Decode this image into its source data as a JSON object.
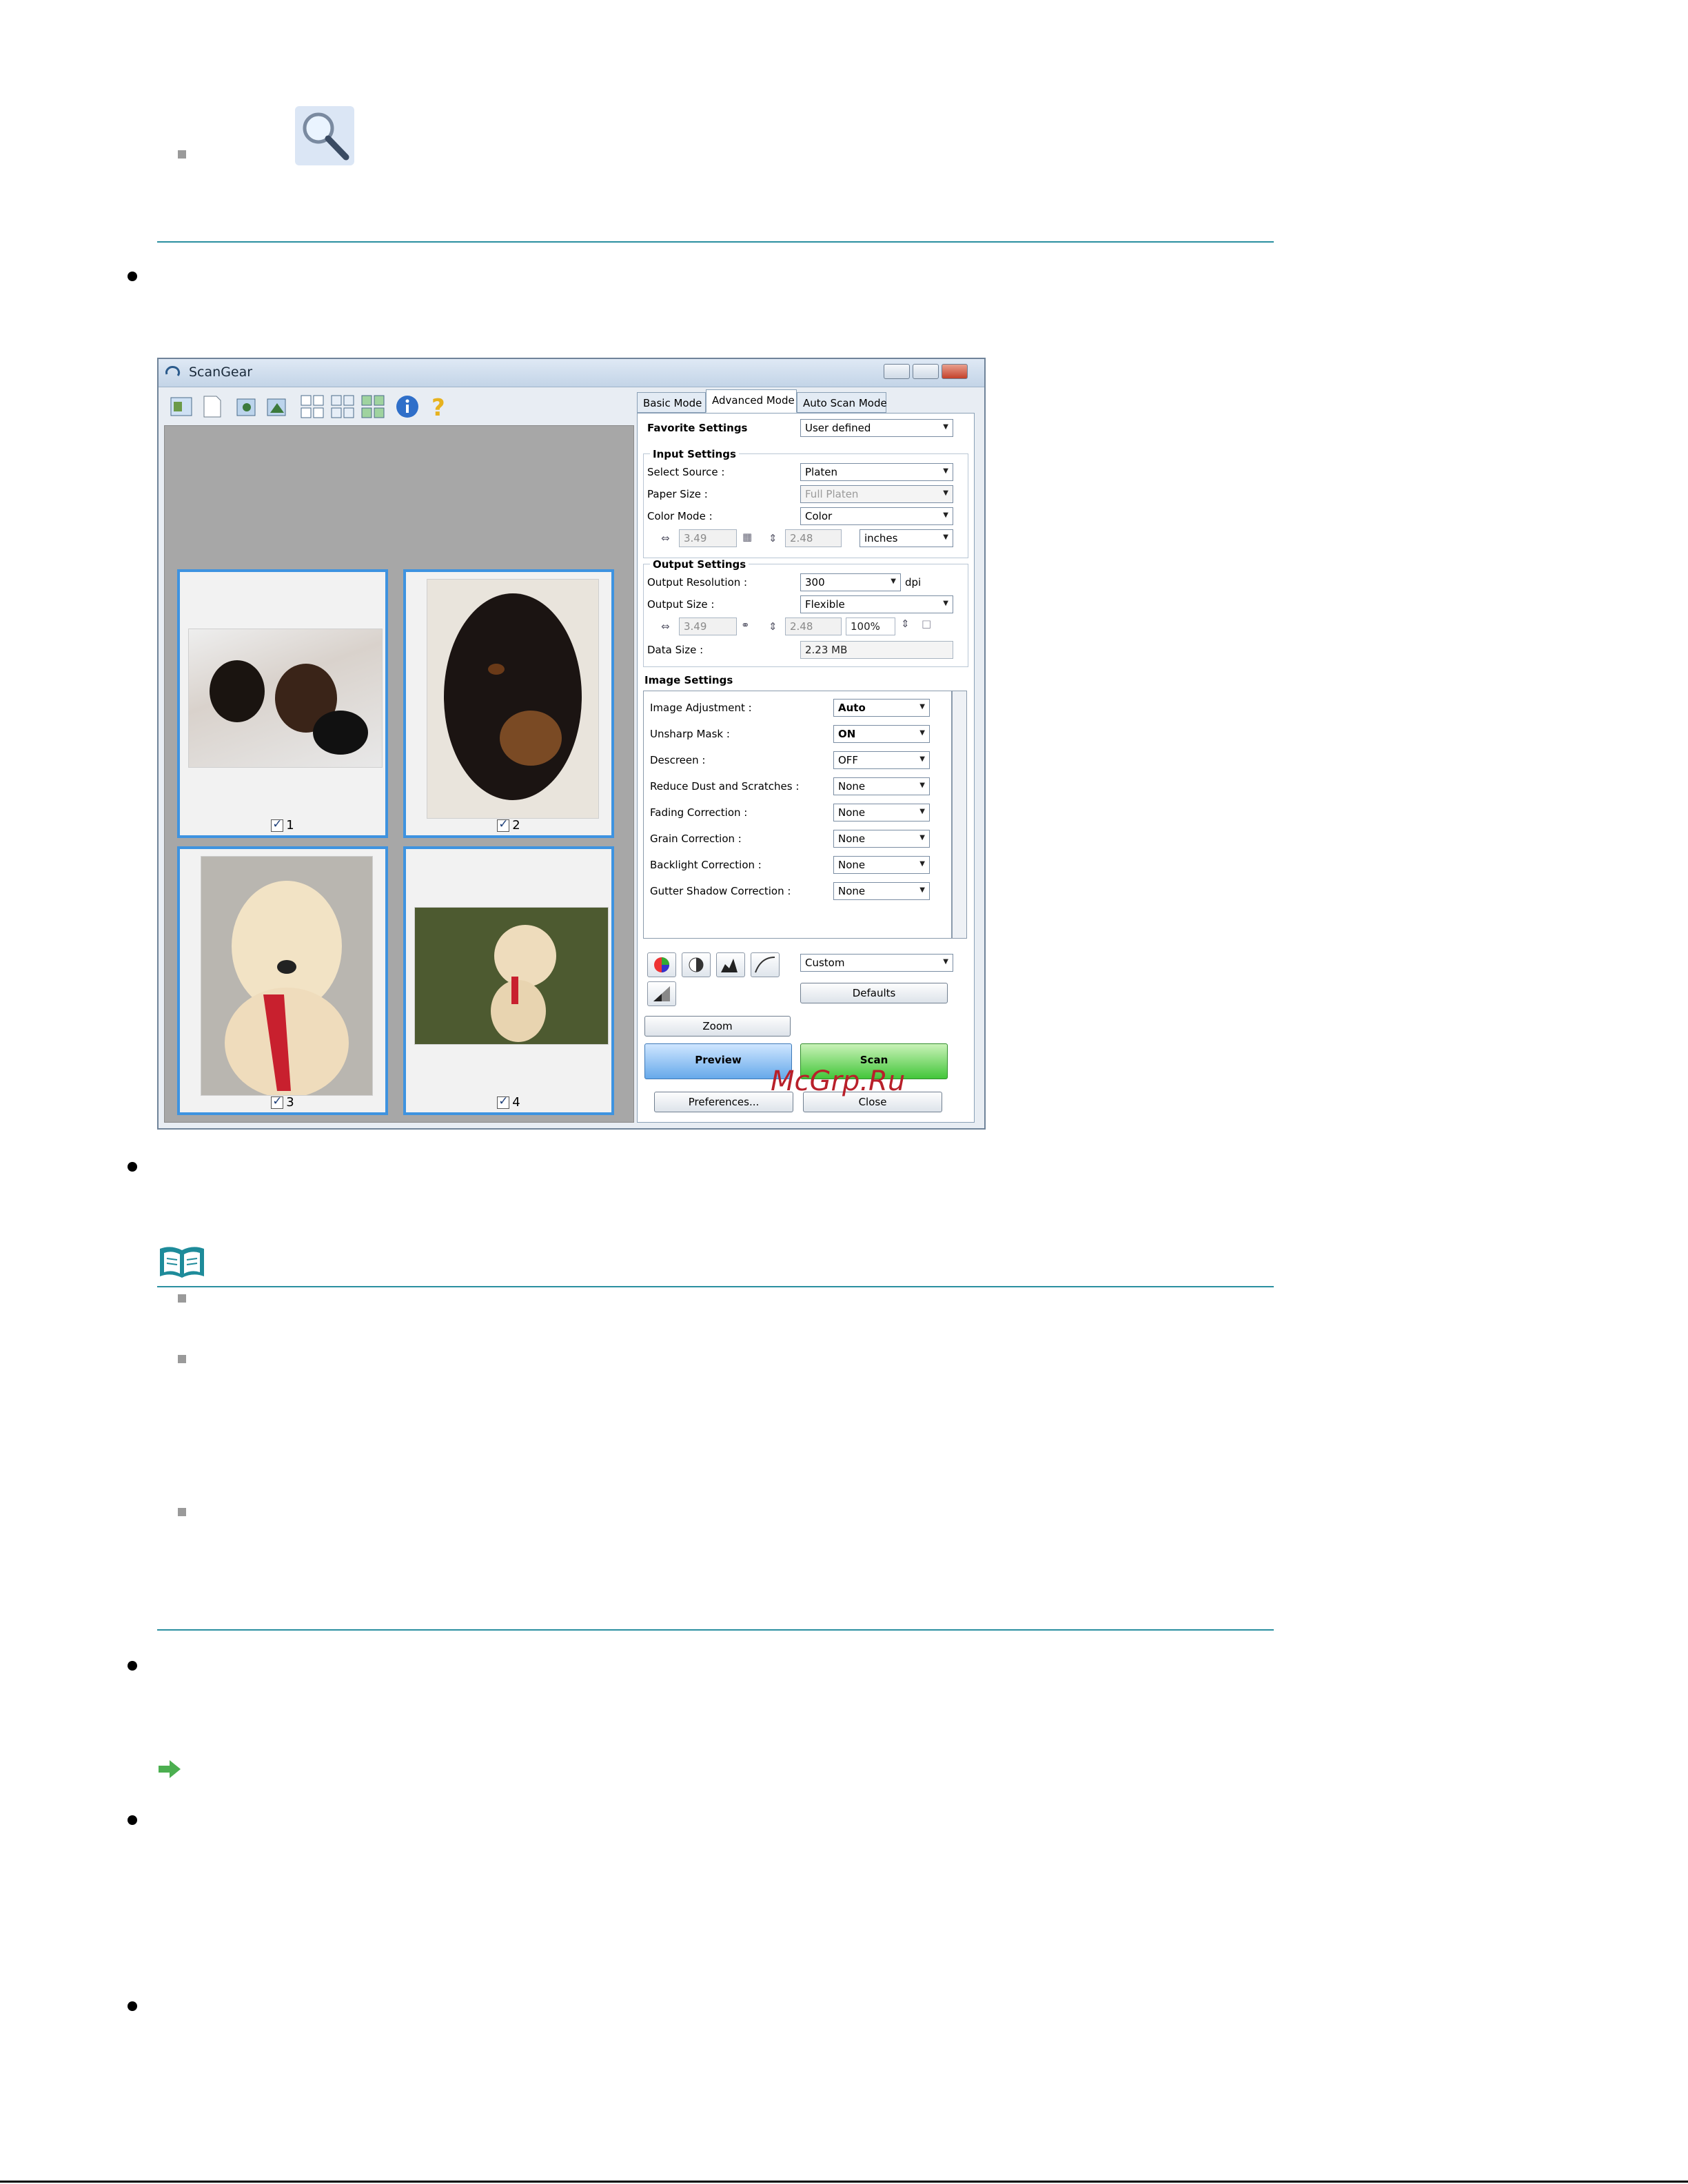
{
  "window": {
    "title": "ScanGear",
    "tabs": [
      "Basic Mode",
      "Advanced Mode",
      "Auto Scan Mode"
    ],
    "favorite_settings": {
      "label": "Favorite Settings",
      "value": "User defined"
    },
    "input_settings": {
      "heading": "Input Settings",
      "select_source": {
        "label": "Select Source :",
        "value": "Platen"
      },
      "paper_size": {
        "label": "Paper Size :",
        "value": "Full Platen"
      },
      "color_mode": {
        "label": "Color Mode :",
        "value": "Color"
      },
      "width": "3.49",
      "height": "2.48",
      "unit": "inches"
    },
    "output_settings": {
      "heading": "Output Settings",
      "resolution": {
        "label": "Output Resolution :",
        "value": "300",
        "unit": "dpi"
      },
      "output_size": {
        "label": "Output Size :",
        "value": "Flexible"
      },
      "width": "3.49",
      "height": "2.48",
      "scale": "100%",
      "data_size": {
        "label": "Data Size :",
        "value": "2.23 MB"
      }
    },
    "image_settings": {
      "heading": "Image Settings",
      "rows": [
        {
          "label": "Image Adjustment :",
          "value": "Auto"
        },
        {
          "label": "Unsharp Mask :",
          "value": "ON"
        },
        {
          "label": "Descreen :",
          "value": "OFF"
        },
        {
          "label": "Reduce Dust and Scratches :",
          "value": "None"
        },
        {
          "label": "Fading Correction :",
          "value": "None"
        },
        {
          "label": "Grain Correction :",
          "value": "None"
        },
        {
          "label": "Backlight Correction :",
          "value": "None"
        },
        {
          "label": "Gutter Shadow Correction :",
          "value": "None"
        }
      ]
    },
    "tone_select": "Custom",
    "buttons": {
      "defaults": "Defaults",
      "zoom": "Zoom",
      "preview": "Preview",
      "scan": "Scan",
      "preferences": "Preferences...",
      "close": "Close"
    },
    "thumbnails": [
      "1",
      "2",
      "3",
      "4"
    ]
  },
  "watermark": "McGrp.Ru",
  "colors": {
    "rule": "#2a8fa0",
    "thumb_border": "#3e93e0",
    "note_icon": "#1e8b9a",
    "arrow": "#4caf50"
  },
  "icons": [
    "zoom-magnifier-icon",
    "note-book-icon",
    "green-arrow-icon"
  ]
}
